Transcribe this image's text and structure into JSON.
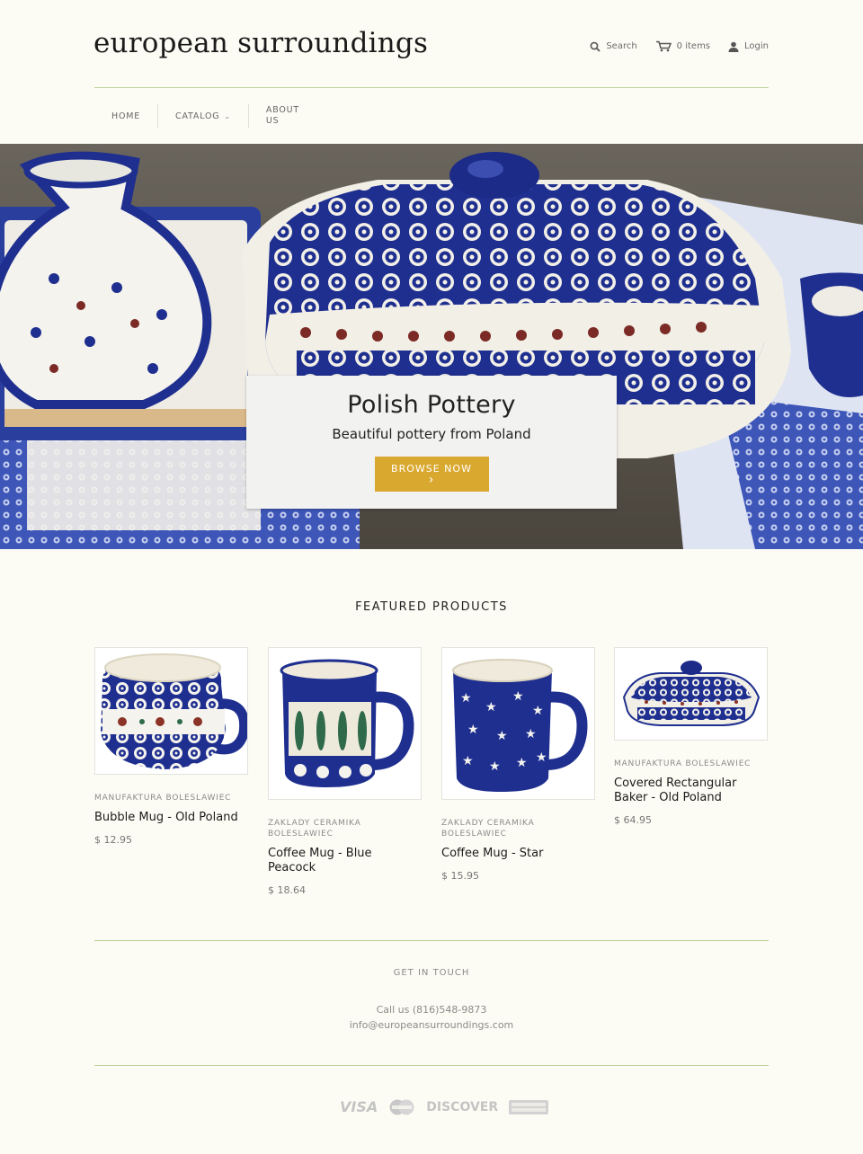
{
  "header": {
    "logo": "european surroundings",
    "search_label": "Search",
    "cart_label": "0 items",
    "login_label": "Login"
  },
  "nav": {
    "home": "HOME",
    "catalog": "CATALOG",
    "about_line1": "ABOUT",
    "about_line2": "US"
  },
  "hero": {
    "title": "Polish Pottery",
    "subtitle": "Beautiful pottery from Poland",
    "button": "BROWSE NOW",
    "button_arrow": "›"
  },
  "featured": {
    "title": "FEATURED PRODUCTS",
    "products": [
      {
        "vendor": "MANUFAKTURA BOLESLAWIEC",
        "name": "Bubble Mug - Old Poland",
        "price": "$ 12.95"
      },
      {
        "vendor": "ZAKLADY CERAMIKA BOLESLAWIEC",
        "name": "Coffee Mug - Blue Peacock",
        "price": "$ 18.64"
      },
      {
        "vendor": "ZAKLADY CERAMIKA BOLESLAWIEC",
        "name": "Coffee Mug - Star",
        "price": "$ 15.95"
      },
      {
        "vendor": "MANUFAKTURA BOLESLAWIEC",
        "name": "Covered Rectangular Baker - Old Poland",
        "price": "$ 64.95"
      }
    ]
  },
  "footer": {
    "title": "GET IN TOUCH",
    "phone": "Call us (816)548-9873",
    "email": "info@europeansurroundings.com",
    "payments": [
      "VISA",
      "DISCOVER"
    ]
  },
  "colors": {
    "background": "#fdfcf4",
    "accent_rule": "#bfd19a",
    "button": "#d9a82e",
    "pottery_blue": "#1f2f8f"
  },
  "icons": [
    "search-icon",
    "cart-icon",
    "user-icon",
    "chevron-down-icon",
    "visa-icon",
    "mastercard-icon",
    "discover-icon",
    "amex-icon"
  ]
}
